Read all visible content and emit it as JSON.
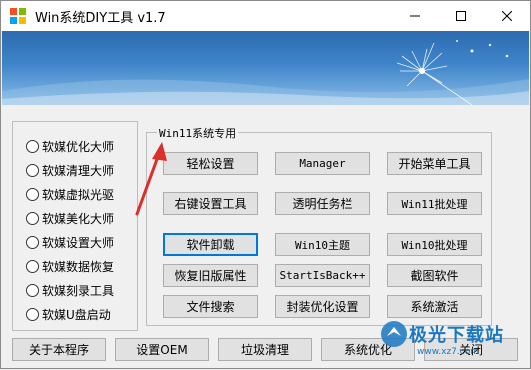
{
  "window": {
    "title": "Win系统DIY工具 v1.7"
  },
  "left_group": {
    "items": [
      {
        "label": "软媒优化大师"
      },
      {
        "label": "软媒清理大师"
      },
      {
        "label": "软媒虚拟光驱"
      },
      {
        "label": "软媒美化大师"
      },
      {
        "label": "软媒设置大师"
      },
      {
        "label": "软媒数据恢复"
      },
      {
        "label": "软媒刻录工具"
      },
      {
        "label": "软媒U盘启动"
      }
    ]
  },
  "right_group": {
    "label": "Win11系统专用",
    "win11_buttons": [
      "轻松设置",
      "Manager",
      "开始菜单工具",
      "右键设置工具",
      "透明任务栏",
      "Win11批处理"
    ],
    "buttons": [
      "软件卸载",
      "Win10主题",
      "Win10批处理",
      "恢复旧版属性",
      "StartIsBack++",
      "截图软件",
      "文件搜索",
      "封装优化设置",
      "系统激活"
    ]
  },
  "bottom_bar": [
    "关于本程序",
    "设置OEM",
    "垃圾清理",
    "系统优化",
    "关闭"
  ],
  "watermark": {
    "text": "极光下载站",
    "url": "www.xz7.com"
  },
  "colors": {
    "accent": "#0078d7",
    "annotation_arrow": "#d9302a"
  }
}
